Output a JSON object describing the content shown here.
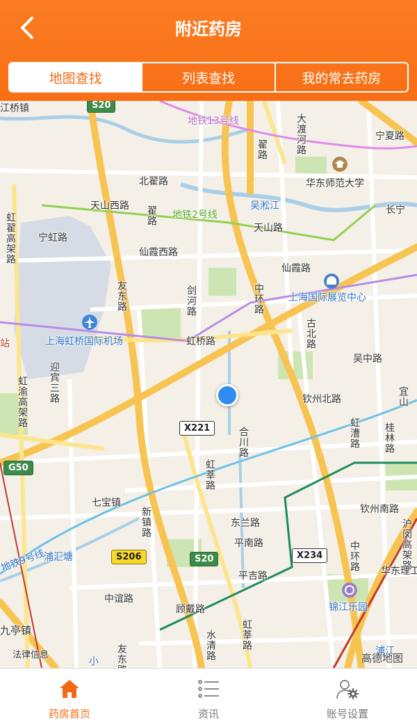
{
  "header": {
    "title": "附近药房"
  },
  "segments": [
    "地图查找",
    "列表查找",
    "我的常去药房"
  ],
  "map": {
    "labels": {
      "jiangqiao": "江桥镇",
      "line13": "地铁13号线",
      "dadu": "大渡河路",
      "ningxia": "宁夏路",
      "ecnu": "华东师范大学",
      "zhaitang": "翟路",
      "beizhai": "北翟路",
      "tianshan_w": "天山西路",
      "line2": "地铁2号线",
      "songjiang": "吴淞江",
      "tianshan": "天山路",
      "changning": "长宁",
      "hongqiao_n": "虹翟高架路",
      "ninghong": "宁虹路",
      "xianxia_w": "仙霞西路",
      "xianxia": "仙霞路",
      "youdong": "友东路",
      "jianhe": "剑河路",
      "zhonghuan_n": "中环路",
      "expo": "上海国际展览中心",
      "airport": "上海虹桥国际机场",
      "hongqiao_rd": "虹桥路",
      "gubei": "古北路",
      "wuzhong": "吴中路",
      "zhan": "站",
      "yingbin": "迎宾三路",
      "hongyu": "虹渝高架路",
      "qinzhou_n": "钦州北路",
      "yishan": "宜山",
      "hongcao": "虹漕路",
      "guilin": "桂林路",
      "hexin": "合川路",
      "hongxin": "虹莘路",
      "qibao": "七宝镇",
      "xinzhen": "新镇路",
      "donglan": "东兰路",
      "pingnan": "平南路",
      "qinzhou_s": "钦州南路",
      "zhonghuan_s": "中环路",
      "huamin": "沪闵高架路",
      "line9": "地铁9号线",
      "puhuitang": "浦汇塘",
      "zhongyi": "中谊路",
      "pingji": "平吉路",
      "ecust": "华东理工",
      "jinjiang": "锦江乐园",
      "gudai": "顾戴路",
      "jiuting": "九亭镇",
      "fazhi": "法律信息",
      "shuiqing": "水清路",
      "hongxin2": "虹莘路",
      "xiaoguan": "小",
      "youdong2": "友东路",
      "pujiang": "浦江"
    },
    "shields": {
      "s20_top": "S20",
      "x221": "X221",
      "g50": "G50",
      "s206": "S206",
      "s20_bot": "S20",
      "x234": "X234"
    },
    "attribution": "高德地图"
  },
  "tabs": [
    "药房首页",
    "资讯",
    "账号设置"
  ]
}
